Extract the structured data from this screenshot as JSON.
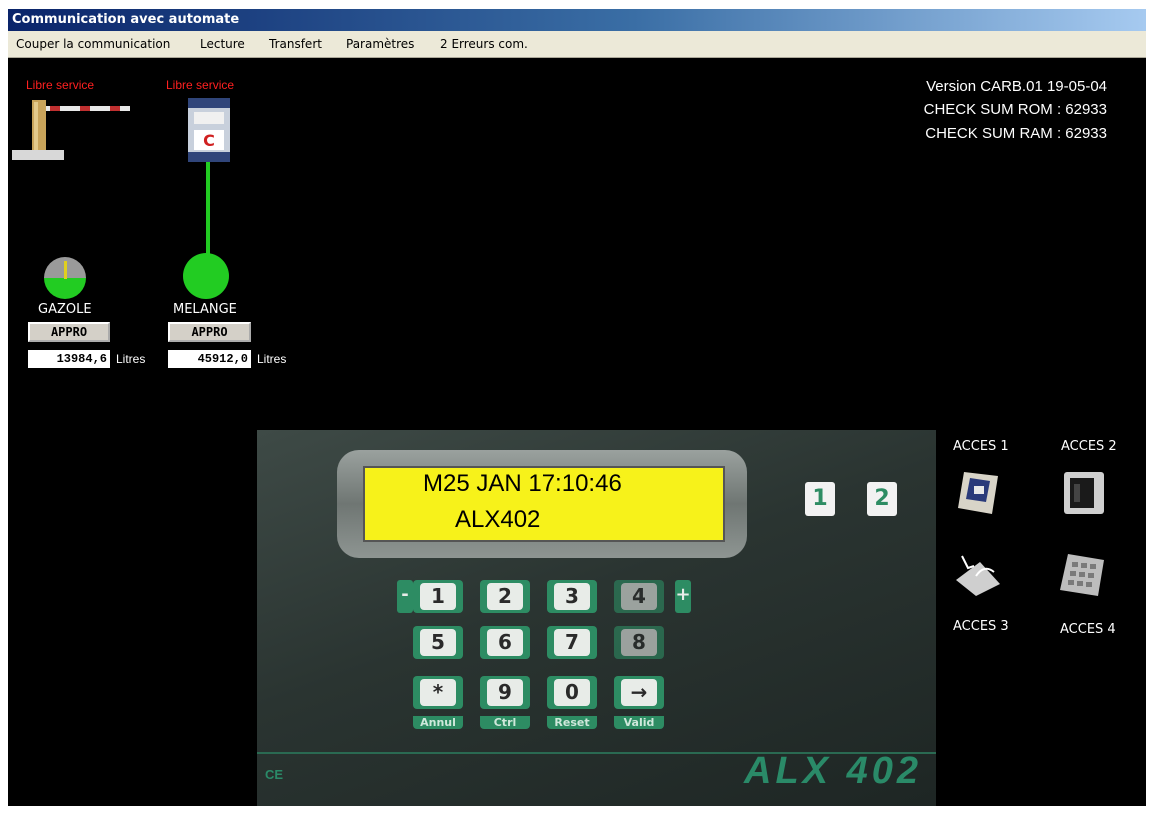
{
  "window": {
    "title": "Communication avec automate"
  },
  "menu": {
    "items": [
      "Couper la communication",
      "Lecture",
      "Transfert",
      "Paramètres",
      "2 Erreurs com."
    ]
  },
  "status": {
    "barrier": "Libre service",
    "pump": "Libre service"
  },
  "tanks": [
    {
      "name": "GAZOLE",
      "button": "APPRO",
      "quantity": "13984,6",
      "unit": "Litres"
    },
    {
      "name": "MELANGE",
      "button": "APPRO",
      "quantity": "45912,0",
      "unit": "Litres"
    }
  ],
  "version": {
    "line1": "Version  CARB.01 19-05-04",
    "line2": "CHECK SUM ROM : 62933",
    "line3": "CHECK SUM RAM : 62933"
  },
  "terminal": {
    "lcd_line1": "M25 JAN 17:10:46",
    "lcd_line2": "ALX402",
    "brand": "ALX 402",
    "ce": "CE",
    "selectors": [
      "1",
      "2"
    ],
    "keys": [
      "1",
      "2",
      "3",
      "4",
      "5",
      "6",
      "7",
      "8",
      "*",
      "9",
      "0",
      "→"
    ],
    "minus": "-",
    "plus": "+",
    "key_labels": [
      "Annul",
      "Ctrl",
      "Reset",
      "Valid"
    ]
  },
  "access": {
    "labels": [
      "ACCES 1",
      "ACCES 2",
      "ACCES 3",
      "ACCES 4"
    ]
  },
  "colors": {
    "status_text": "#ff2020",
    "pipe": "#22cc22",
    "lcd": "#f7f21a",
    "keypad": "#2d8c63"
  }
}
